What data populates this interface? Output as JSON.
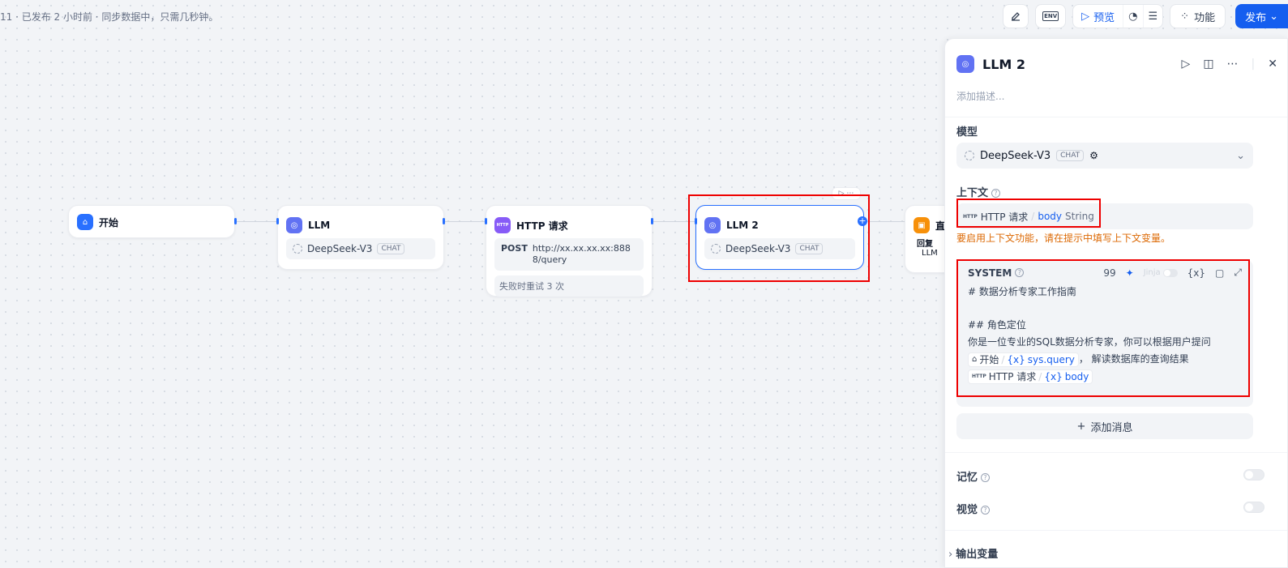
{
  "status_text": "11 · 已发布 2 小时前 · 同步数据中，只需几秒钟。",
  "toolbar": {
    "env_label": "ENV",
    "preview_label": "预览",
    "features_label": "功能",
    "publish_label": "发布"
  },
  "nodes": {
    "start": {
      "title": "开始"
    },
    "llm": {
      "title": "LLM",
      "model": "DeepSeek-V3",
      "badge": "CHAT"
    },
    "http": {
      "title": "HTTP 请求",
      "method": "POST",
      "url": "http://xx.xx.xx.xx:8888/query",
      "retry": "失败时重试 3 次",
      "icon_text": "HTTP"
    },
    "llm2": {
      "title": "LLM 2",
      "model": "DeepSeek-V3",
      "badge": "CHAT"
    },
    "answer": {
      "title": "直",
      "sub1": "回复",
      "sub2": "LLM"
    }
  },
  "panel": {
    "title": "LLM 2",
    "desc_placeholder": "添加描述...",
    "model_label": "模型",
    "model_name": "DeepSeek-V3",
    "model_badge": "CHAT",
    "context_label": "上下文",
    "context_http_tag": "HTTP",
    "context_node": "HTTP 请求",
    "context_var": "body",
    "context_type": "String",
    "context_warning": "要启用上下文功能，请在提示中填写上下文变量。",
    "system": {
      "title": "SYSTEM",
      "count": "99",
      "jinja": "Jinja",
      "var_btn": "{x}",
      "line1": "# 数据分析专家工作指南",
      "line2": "## 角色定位",
      "line3": "你是一位专业的SQL数据分析专家，你可以根据用户提问",
      "chip1_node": "开始",
      "chip1_var": "sys.query",
      "line4_suffix": "， 解读数据库的查询结果",
      "chip2_http": "HTTP",
      "chip2_node": "HTTP 请求",
      "chip2_var": "body",
      "var_prefix": "{x}"
    },
    "add_message": "添加消息",
    "memory_label": "记忆",
    "vision_label": "视觉",
    "output_label": "输出变量"
  }
}
